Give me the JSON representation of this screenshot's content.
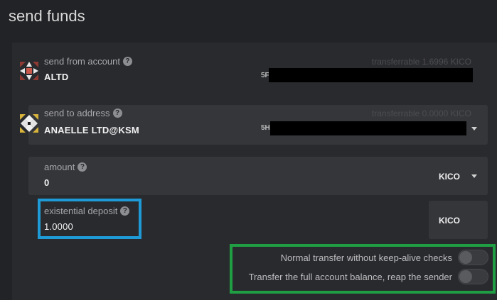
{
  "title": "send funds",
  "from": {
    "label": "send from account",
    "name": "ALTD",
    "transferrable_label": "transferrable",
    "transferrable_value": "1.6996",
    "transferrable_unit": "KICO",
    "address_prefix": "5F"
  },
  "to": {
    "label": "send to address",
    "name": "ANAELLE LTD@KSM",
    "transferrable_label": "transferrable",
    "transferrable_value": "0.0000",
    "transferrable_unit": "KICO",
    "address_prefix": "5H"
  },
  "amount": {
    "label": "amount",
    "value": "0",
    "unit": "KICO"
  },
  "deposit": {
    "label": "existential deposit",
    "value": "1.0000",
    "unit": "KICO"
  },
  "toggles": [
    {
      "label": "Normal transfer without keep-alive checks",
      "on": false
    },
    {
      "label": "Transfer the full account balance, reap the sender",
      "on": false
    }
  ],
  "colors": {
    "highlight_blue": "#1e9bd7",
    "highlight_green": "#1f9e43"
  }
}
